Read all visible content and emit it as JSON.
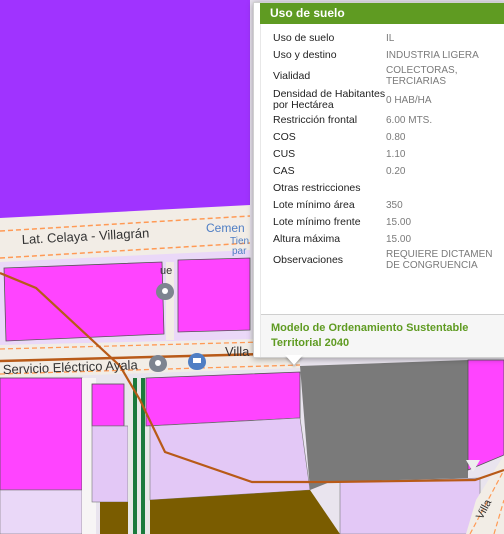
{
  "map": {
    "road_labels": {
      "top_road": "Lat. Celaya - Villagrán",
      "bottom_road": "Villa",
      "poi_service": "Servicio Eléctrico Ayala",
      "poi_cemetery": "Cemen",
      "poi_cemetery_sub1": "Tien",
      "poi_cemetery_sub2": "par",
      "stub_fragment": "ue",
      "right_fragment": "Villa"
    },
    "colors": {
      "industrial_purple": "#a033ff",
      "magenta_block": "#ff44ff",
      "light_lilac": "#e3c8f6",
      "grey_parcel": "#7a7a7a",
      "brown_parcel": "#7a5c00",
      "route_line": "#b85a18",
      "road_fill": "#f2ede6"
    }
  },
  "popup": {
    "title": "Uso de suelo",
    "rows": [
      {
        "key": "Uso de suelo",
        "value": "IL"
      },
      {
        "key": "Uso y destino",
        "value": "INDUSTRIA LIGERA"
      },
      {
        "key": "Vialidad",
        "value": "COLECTORAS, TERCIARIAS"
      },
      {
        "key": "Densidad de Habitantes por Hectárea",
        "value": "0 HAB/HA"
      },
      {
        "key": "Restricción frontal",
        "value": "6.00 MTS."
      },
      {
        "key": "COS",
        "value": "0.80"
      },
      {
        "key": "CUS",
        "value": "1.10"
      },
      {
        "key": "CAS",
        "value": "0.20"
      },
      {
        "key": "Otras restricciones",
        "value": ""
      },
      {
        "key": "Lote mínimo área",
        "value": "350"
      },
      {
        "key": "Lote mínimo frente",
        "value": "15.00"
      },
      {
        "key": "Altura máxima",
        "value": "15.00"
      },
      {
        "key": "Observaciones",
        "value": "REQUIERE DICTAMEN DE CONGRUENCIA"
      }
    ],
    "footer_link": "Modelo de Ordenamiento Sustentable Territorial 2040",
    "accent_color": "#5f9b22"
  }
}
